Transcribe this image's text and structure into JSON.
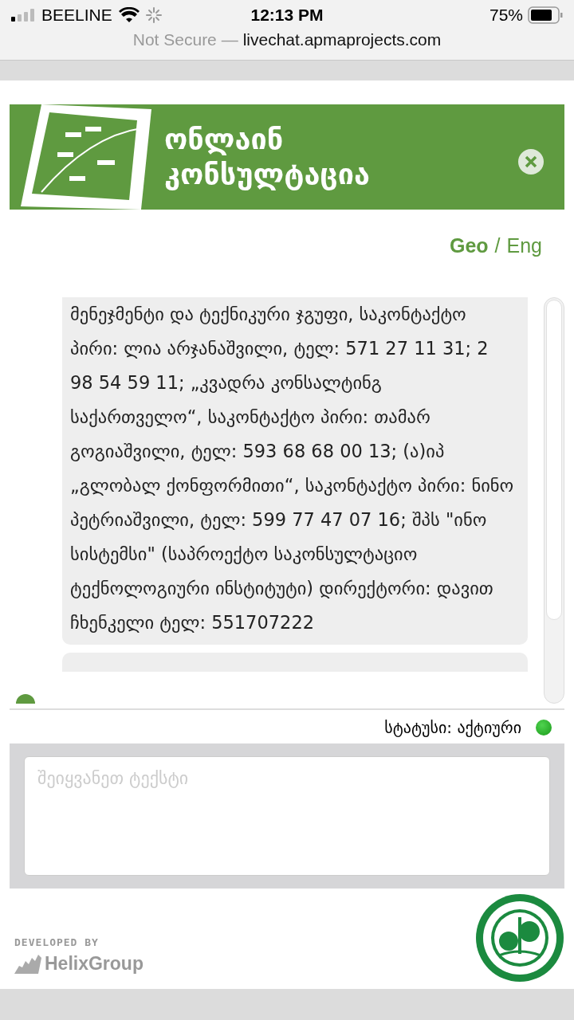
{
  "status_bar": {
    "carrier": "BEELINE",
    "time": "12:13 PM",
    "battery": "75%"
  },
  "address_bar": {
    "security": "Not Secure —",
    "url": "livechat.apmaprojects.com"
  },
  "banner": {
    "title": "ონლაინ კონსულტაცია"
  },
  "languages": [
    {
      "label": "Geo",
      "selected": true
    },
    {
      "label": "Eng",
      "selected": false
    }
  ],
  "language_separator": "/",
  "messages": [
    {
      "text": "მენეჯმენტი და ტექნიკური ჯგუფი, საკონტაქტო პირი: ლია არჯანაშვილი, ტელ: 571 27 11 31; 2 98 54 59 11; „კვადრა კონსალტინგ საქართველო“, საკონტაქტო პირი: თამარ გოგიაშვილი, ტელ: 593 68 68 00 13; (ა)იპ „გლობალ ქონფორმითი“, საკონტაქტო პირი: ნინო პეტრიაშვილი, ტელ: 599 77 47 07 16; შპს \"ინო სისტემსი\" (საპროექტო საკონსულტაციო ტექნოლოგიური ინსტიტუტი) დირექტორი: დავით ჩხენკელი ტელ: 551707222"
    }
  ],
  "chat_status": {
    "label": "სტატუსი: აქტიური",
    "online": true
  },
  "message_input": {
    "placeholder": "შეიყვანეთ ტექსტი"
  },
  "footer": {
    "developed_by": "DEVELOPED BY",
    "developer": "HelixGroup"
  }
}
